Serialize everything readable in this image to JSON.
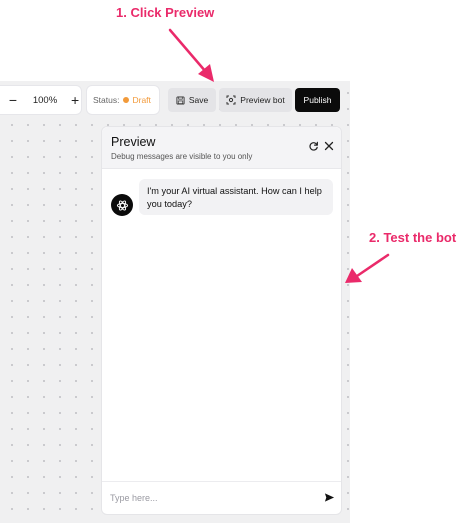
{
  "annotations": {
    "step1": "1. Click Preview",
    "step2": "2. Test the bot",
    "color": "#ea2a6a"
  },
  "toolbar": {
    "zoom_out": "−",
    "zoom_level": "100%",
    "zoom_in": "+",
    "status_label": "Status:",
    "status_value": "Draft",
    "status_color": "#f29a3a",
    "save_label": "Save",
    "preview_label": "Preview bot",
    "publish_label": "Publish"
  },
  "preview_panel": {
    "title": "Preview",
    "subtitle": "Debug messages are visible to you only",
    "messages": [
      {
        "sender": "bot",
        "text": "I'm your AI virtual assistant. How can I help you today?"
      }
    ],
    "input_placeholder": "Type here..."
  },
  "icons": [
    "save-icon",
    "preview-icon",
    "refresh-icon",
    "close-icon",
    "bot-avatar-icon",
    "send-icon"
  ]
}
